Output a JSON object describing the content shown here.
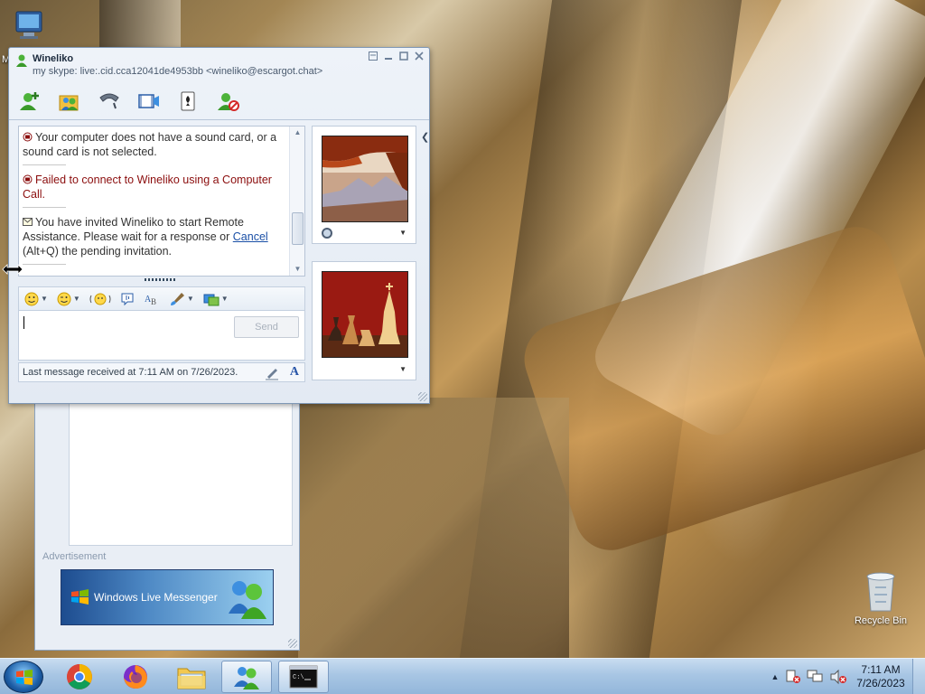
{
  "desktop": {
    "recycle_bin_label": "Recycle Bin",
    "computer_label": "M"
  },
  "contact_window": {
    "advertisement_label": "Advertisement",
    "banner_text": "Windows Live Messenger"
  },
  "chat_window": {
    "contact_name": "Wineliko",
    "contact_subtitle": "my skype: live:.cid.cca12041de4953bb <wineliko@escargot.chat>",
    "toolbar": {
      "icons": [
        "invite-contact-icon",
        "share-folders-icon",
        "call-icon",
        "video-icon",
        "games-icon",
        "block-icon"
      ]
    },
    "messages": [
      {
        "type": "info",
        "text": "Your computer does not have a sound card, or a sound card is not selected."
      },
      {
        "type": "error",
        "text": "Failed to connect to Wineliko using a Computer Call."
      },
      {
        "type": "invite",
        "text_before": "You have invited Wineliko to start Remote Assistance. Please wait for a response or ",
        "link": "Cancel",
        "text_after": " (Alt+Q) the pending invitation."
      }
    ],
    "send_label": "Send",
    "status_text": "Last message received at 7:11 AM on 7/26/2023.",
    "font_button_label": "A"
  },
  "taskbar": {
    "items": [
      "start-button",
      "chrome",
      "firefox",
      "file-explorer",
      "windows-live-messenger",
      "command-prompt"
    ],
    "active_item": "windows-live-messenger",
    "clock_time": "7:11 AM",
    "clock_date": "7/26/2023"
  },
  "colors": {
    "error_text": "#8b0d0d",
    "link": "#1a4fa6",
    "taskbar": "#a8c6e4"
  }
}
